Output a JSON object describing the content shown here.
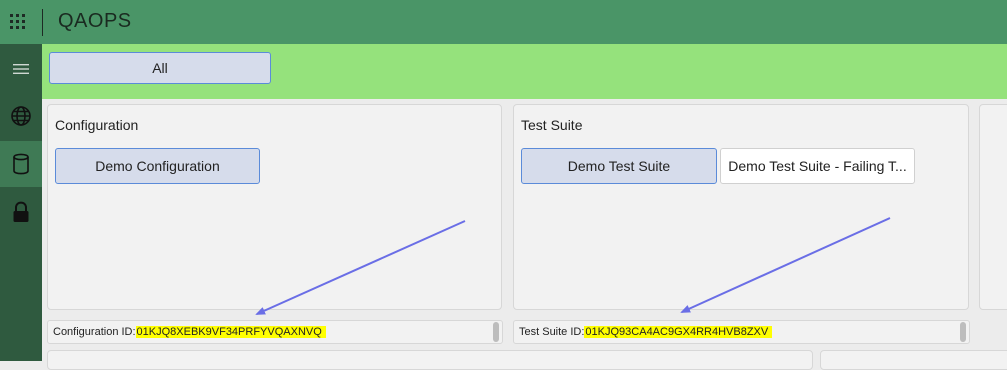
{
  "app": {
    "title": "QAOPS"
  },
  "topbar": {
    "menu_icon": "apps-grid-icon"
  },
  "sidebar": {
    "items": [
      {
        "icon": "hamburger-menu-icon"
      },
      {
        "icon": "globe-icon"
      },
      {
        "icon": "database-icon",
        "active": true
      },
      {
        "icon": "lock-icon"
      }
    ]
  },
  "filter": {
    "all_label": "All"
  },
  "configuration_panel": {
    "title": "Configuration",
    "items": [
      {
        "label": "Demo Configuration",
        "selected": true
      }
    ],
    "id_label": "Configuration ID:",
    "id_value": "01KJQ8XEBK9VF34PRFYVQAXNVQ"
  },
  "test_suite_panel": {
    "title": "Test Suite",
    "items": [
      {
        "label": "Demo Test Suite",
        "selected": true
      },
      {
        "label": "Demo Test Suite - Failing T...",
        "selected": false
      }
    ],
    "id_label": "Test Suite ID:",
    "id_value": "01KJQ93CA4AC9GX4RR4HVB8ZXV"
  },
  "colors": {
    "topbar": "#4a9567",
    "sidebar": "#2f5a3f",
    "filterbar": "#95e27c",
    "selected_button": "#d6dceb",
    "selected_border": "#5b8bd9",
    "highlight": "#ffff00",
    "annotation_arrow": "#6a6ee6"
  }
}
